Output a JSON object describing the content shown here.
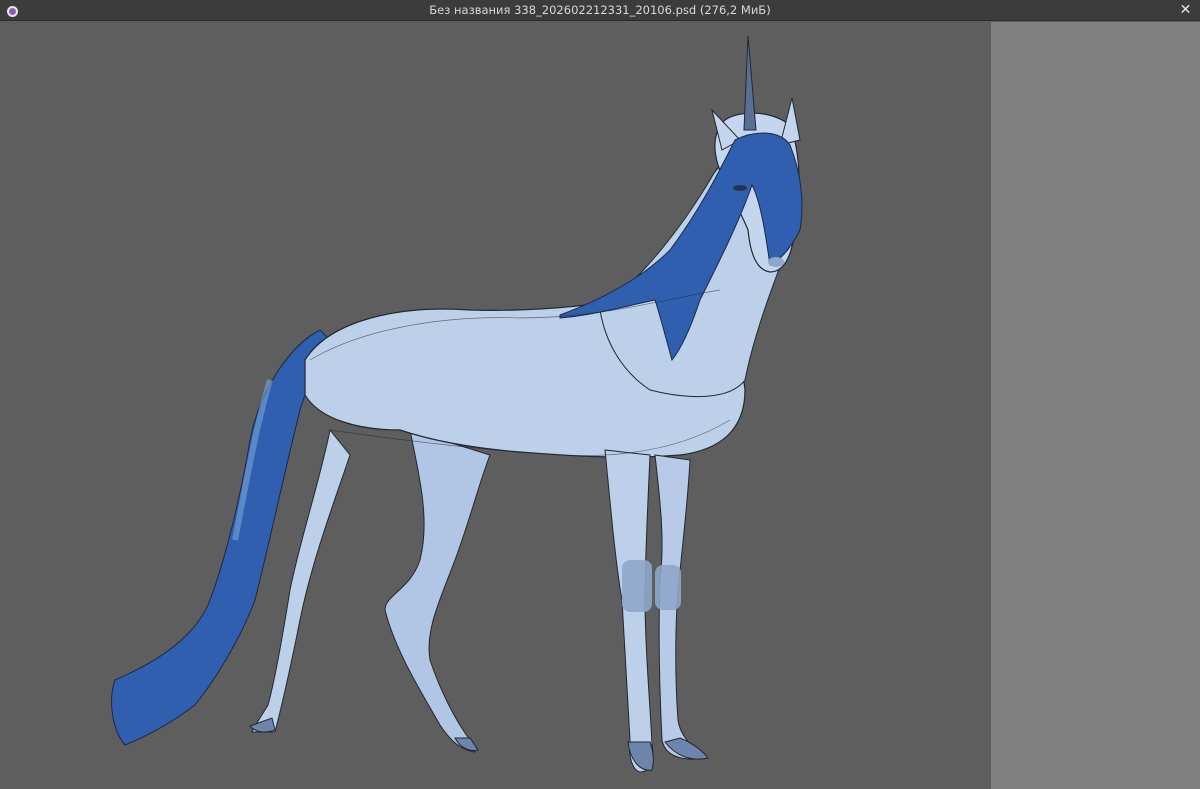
{
  "window": {
    "title": "Без названия 338_202602212331_20106.psd (276,2 МиБ)",
    "app_icon": "app-logo-icon",
    "close_icon": "close-icon",
    "close_glyph": "✕"
  },
  "canvas": {
    "artwork": "unicorn-sketch-image",
    "background_color": "#5e5e5e"
  },
  "side_panel": {
    "background_color": "#808080"
  },
  "colors": {
    "mane": "#2f5fae",
    "body": "#bcd0ea",
    "shadow": "#8ea6c9",
    "line": "#222831"
  }
}
